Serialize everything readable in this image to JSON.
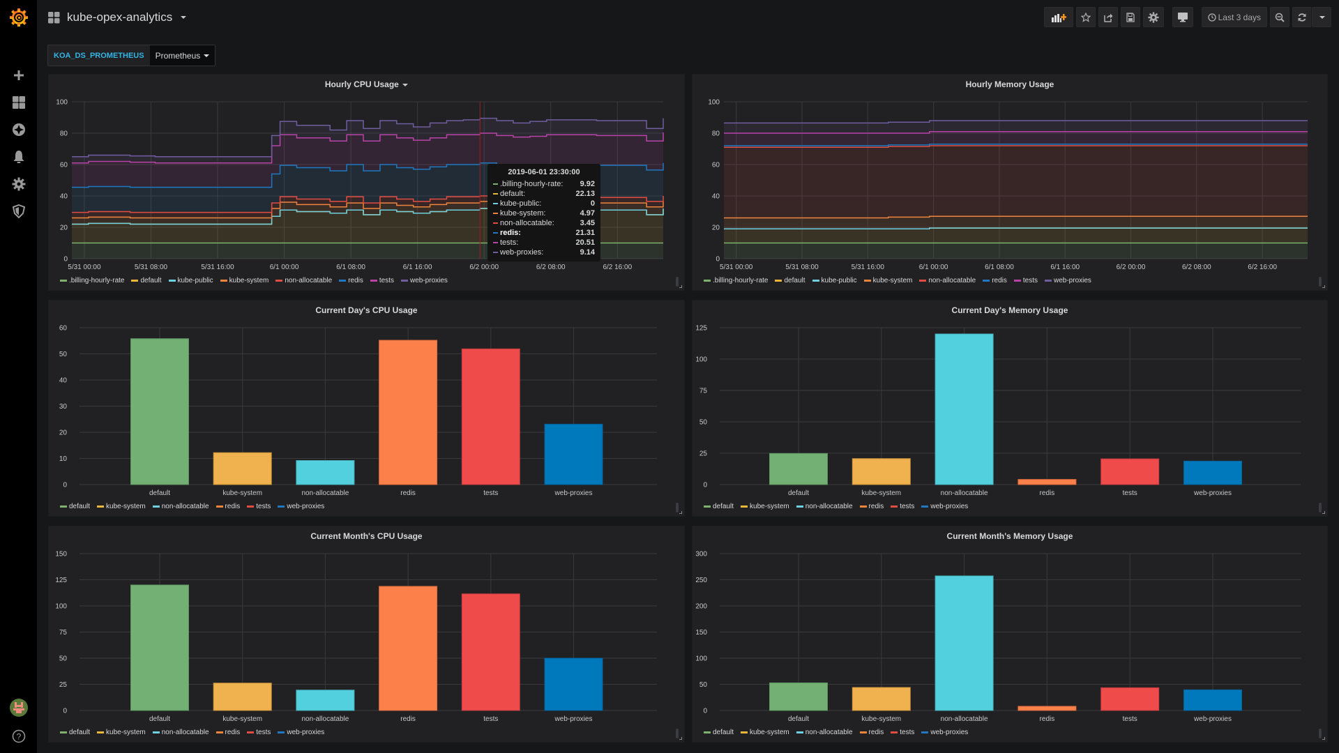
{
  "app": {
    "dashboard_title": "kube-opex-analytics",
    "sidemenu": [
      {
        "icon": "plus-icon",
        "label": "Create"
      },
      {
        "icon": "dashboards-icon",
        "label": "Dashboards"
      },
      {
        "icon": "explore-compass-icon",
        "label": "Explore"
      },
      {
        "icon": "alerting-bell-icon",
        "label": "Alerting"
      },
      {
        "icon": "configuration-gear-icon",
        "label": "Configuration"
      },
      {
        "icon": "server-admin-shield-icon",
        "label": "Server Admin"
      }
    ],
    "help_icon": "help-icon"
  },
  "toolbar": {
    "add_panel": "add-panel-icon",
    "star": "star-icon",
    "share": "share-icon",
    "save": "save-icon",
    "settings": "settings-icon",
    "tv_mode": "tv-mode-icon",
    "time_range_label": "Last 3 days",
    "zoom_out": "zoom-out-icon",
    "refresh": "refresh-icon"
  },
  "variables": {
    "label": "KOA_DS_PROMETHEUS",
    "value": "Prometheus"
  },
  "colors": {
    "billing": "#7eb26d",
    "default": "#eab839",
    "kube-public": "#6ed0e0",
    "kube-system": "#ef843c",
    "non-allocatable": "#e24d42",
    "redis": "#1f78c1",
    "tests": "#ba43a9",
    "web-proxies": "#705da0",
    "bar-default": "#73b074",
    "bar-kube-system": "#f0b24f",
    "bar-non-allocatable": "#53d0de",
    "bar-redis": "#fb804a",
    "bar-tests": "#ef4b4b",
    "bar-web-proxies": "#0079bc"
  },
  "tooltip": {
    "title": "2019-06-01 23:30:00",
    "rows": [
      {
        "name": ".billing-hourly-rate:",
        "value": "9.92",
        "color": "#7eb26d"
      },
      {
        "name": "default:",
        "value": "22.13",
        "color": "#eab839"
      },
      {
        "name": "kube-public:",
        "value": "0",
        "color": "#6ed0e0"
      },
      {
        "name": "kube-system:",
        "value": "4.97",
        "color": "#ef843c"
      },
      {
        "name": "non-allocatable:",
        "value": "3.45",
        "color": "#e24d42"
      },
      {
        "name": "redis:",
        "value": "21.31",
        "color": "#1f78c1"
      },
      {
        "name": "tests:",
        "value": "20.51",
        "color": "#ba43a9"
      },
      {
        "name": "web-proxies:",
        "value": "9.14",
        "color": "#705da0"
      }
    ]
  },
  "chart_data": [
    {
      "id": "hourly-cpu",
      "type": "area",
      "stacked": true,
      "title": "Hourly CPU Usage",
      "ylim": [
        0,
        100
      ],
      "yticks": [
        0,
        20,
        40,
        60,
        80,
        100
      ],
      "xticks": [
        "5/31 00:00",
        "5/31 08:00",
        "5/31 16:00",
        "6/1 00:00",
        "6/1 08:00",
        "6/1 16:00",
        "6/2 00:00",
        "6/2 08:00",
        "6/2 16:00"
      ],
      "x_range_hours": [
        -1.5,
        69.5
      ],
      "grid": true,
      "legend": "bottom",
      "hover_hour": 47.5,
      "series_names": [
        ".billing-hourly-rate",
        "default",
        "kube-public",
        "kube-system",
        "non-allocatable",
        "redis",
        "tests",
        "web-proxies"
      ],
      "stack_tops": {
        "hours": [
          -1.5,
          0.5,
          2.5,
          5.5,
          8.5,
          12.5,
          16.5,
          19.5,
          22.5,
          23.5,
          25.5,
          27.5,
          29.5,
          31.5,
          33.5,
          35.5,
          37.5,
          39.5,
          41.5,
          43.5,
          45.5,
          47.5,
          49.5,
          51.5,
          53.5,
          55.5,
          57.5,
          59.5,
          61.5,
          63.5,
          65.5,
          67.5,
          69.5
        ],
        ".billing-hourly-rate": [
          10,
          10,
          10,
          10,
          10,
          10,
          10,
          10,
          10,
          10,
          10,
          10,
          10,
          10,
          10,
          10,
          10,
          10,
          10,
          10,
          10,
          10,
          10,
          10,
          10,
          10,
          10,
          10,
          10,
          10,
          10,
          10,
          10
        ],
        "default": [
          22,
          22.5,
          22.5,
          22,
          22,
          22,
          22,
          22,
          27,
          31,
          30,
          30,
          29,
          31,
          28,
          31,
          30,
          29,
          30,
          31,
          31,
          32,
          31,
          30,
          31,
          31,
          31,
          31,
          31,
          31,
          31,
          28,
          32
        ],
        "kube-public": [
          22,
          22.5,
          22.5,
          22,
          22,
          22,
          22,
          22,
          27,
          31,
          30,
          30,
          29,
          31,
          28,
          31,
          30,
          29,
          30,
          31,
          31,
          32,
          31,
          30,
          31,
          31,
          31,
          31,
          31,
          31,
          31,
          28,
          32
        ],
        "kube-system": [
          26,
          26.5,
          26.5,
          26,
          26,
          26,
          26,
          26,
          32,
          36,
          34.5,
          34.5,
          33,
          35.5,
          32,
          35.5,
          34,
          33,
          34.5,
          35.5,
          35.5,
          36.5,
          35.5,
          35,
          35.5,
          35.5,
          35.5,
          35.5,
          35.5,
          35.5,
          35.5,
          33,
          36.5
        ],
        "non-allocatable": [
          29.5,
          30,
          30,
          29.5,
          29.5,
          29.5,
          29.5,
          29.5,
          35.5,
          39.5,
          38,
          38,
          36.5,
          39.5,
          35.5,
          39.5,
          38,
          36.5,
          38,
          39.5,
          39.5,
          40,
          39,
          38.5,
          39,
          39,
          39,
          39,
          39,
          39,
          39,
          36.5,
          40
        ],
        "redis": [
          45.5,
          46,
          46,
          45.5,
          45.5,
          45.5,
          45.5,
          45.5,
          54,
          59.5,
          58,
          58,
          56,
          60,
          56,
          60,
          58,
          57,
          58.5,
          60,
          60,
          61,
          59.5,
          59,
          59.5,
          60,
          60,
          60,
          59.5,
          59.5,
          59.5,
          56.5,
          61
        ],
        "tests": [
          61,
          62,
          62,
          61.5,
          61,
          61,
          61,
          61,
          72,
          79,
          77,
          77,
          75,
          79,
          75,
          79,
          77,
          75.5,
          77,
          79,
          79,
          80,
          78.5,
          77.5,
          78,
          79,
          79,
          79,
          78.5,
          78.5,
          78.5,
          75,
          80.5
        ],
        "web-proxies": [
          65,
          66,
          66,
          65.5,
          65,
          65,
          65,
          65,
          78.5,
          87.5,
          85,
          85,
          82,
          88,
          83,
          88,
          86,
          84,
          86.5,
          88,
          88.5,
          89.5,
          88,
          86.5,
          87.5,
          88.5,
          88.5,
          88.5,
          88,
          88,
          88,
          83,
          89.5
        ]
      }
    },
    {
      "id": "hourly-memory",
      "type": "area",
      "stacked": true,
      "title": "Hourly Memory Usage",
      "ylim": [
        0,
        100
      ],
      "yticks": [
        0,
        20,
        40,
        60,
        80,
        100
      ],
      "xticks": [
        "5/31 00:00",
        "5/31 08:00",
        "5/31 16:00",
        "6/1 00:00",
        "6/1 08:00",
        "6/1 16:00",
        "6/2 00:00",
        "6/2 08:00",
        "6/2 16:00"
      ],
      "x_range_hours": [
        -1.5,
        69.5
      ],
      "grid": true,
      "legend": "bottom",
      "series_names": [
        ".billing-hourly-rate",
        "default",
        "kube-public",
        "kube-system",
        "non-allocatable",
        "redis",
        "tests",
        "web-proxies"
      ],
      "stack_tops": {
        "hours": [
          -1.5,
          8.5,
          18.5,
          23.5,
          33.5,
          43.5,
          53.5,
          63.5,
          69.5
        ],
        ".billing-hourly-rate": [
          10,
          10,
          10,
          10,
          10,
          10,
          10,
          10,
          10
        ],
        "default": [
          19,
          19,
          19,
          19.5,
          19.5,
          19.5,
          19.5,
          19.5,
          19.5
        ],
        "kube-public": [
          19,
          19,
          19,
          19.5,
          19.5,
          19.5,
          19.5,
          19.5,
          19.5
        ],
        "kube-system": [
          26,
          26,
          26.5,
          27,
          27,
          27,
          27,
          27,
          27
        ],
        "non-allocatable": [
          71,
          71,
          71.5,
          72,
          72,
          72,
          72,
          72,
          72
        ],
        "redis": [
          72,
          72,
          72.5,
          73,
          73,
          73,
          73,
          73,
          73
        ],
        "tests": [
          80,
          80,
          80,
          81,
          81,
          81,
          81,
          81,
          81
        ],
        "web-proxies": [
          86.5,
          86.5,
          87,
          88,
          88,
          88,
          88,
          88,
          88
        ]
      }
    },
    {
      "id": "day-cpu",
      "type": "bar",
      "title": "Current Day's CPU Usage",
      "categories": [
        "default",
        "kube-system",
        "non-allocatable",
        "redis",
        "tests",
        "web-proxies"
      ],
      "values": [
        55.8,
        12.2,
        9.2,
        55.2,
        51.9,
        23.1
      ],
      "ylim": [
        0,
        60
      ],
      "yticks": [
        0,
        10,
        20,
        30,
        40,
        50,
        60
      ],
      "grid": true,
      "legend": "bottom"
    },
    {
      "id": "day-memory",
      "type": "bar",
      "title": "Current Day's Memory Usage",
      "categories": [
        "default",
        "kube-system",
        "non-allocatable",
        "redis",
        "tests",
        "web-proxies"
      ],
      "values": [
        24.8,
        20.7,
        120,
        4.1,
        20.5,
        18.7
      ],
      "ylim": [
        0,
        125
      ],
      "yticks": [
        0,
        25,
        50,
        75,
        100,
        125
      ],
      "grid": true,
      "legend": "bottom"
    },
    {
      "id": "month-cpu",
      "type": "bar",
      "title": "Current Month's CPU Usage",
      "categories": [
        "default",
        "kube-system",
        "non-allocatable",
        "redis",
        "tests",
        "web-proxies"
      ],
      "values": [
        120,
        26.2,
        19.5,
        118.7,
        111.5,
        50
      ],
      "ylim": [
        0,
        150
      ],
      "yticks": [
        0,
        25,
        50,
        75,
        100,
        125,
        150
      ],
      "grid": true,
      "legend": "bottom"
    },
    {
      "id": "month-memory",
      "type": "bar",
      "title": "Current Month's Memory Usage",
      "categories": [
        "default",
        "kube-system",
        "non-allocatable",
        "redis",
        "tests",
        "web-proxies"
      ],
      "values": [
        52.8,
        44,
        257.3,
        8,
        43.5,
        39.5
      ],
      "ylim": [
        0,
        300
      ],
      "yticks": [
        0,
        50,
        100,
        150,
        200,
        250,
        300
      ],
      "grid": true,
      "legend": "bottom"
    }
  ],
  "legends": {
    "timeseries": [
      {
        "label": ".billing-hourly-rate",
        "color": "#7eb26d"
      },
      {
        "label": "default",
        "color": "#eab839"
      },
      {
        "label": "kube-public",
        "color": "#6ed0e0"
      },
      {
        "label": "kube-system",
        "color": "#ef843c"
      },
      {
        "label": "non-allocatable",
        "color": "#e24d42"
      },
      {
        "label": "redis",
        "color": "#1f78c1"
      },
      {
        "label": "tests",
        "color": "#ba43a9"
      },
      {
        "label": "web-proxies",
        "color": "#705da0"
      }
    ],
    "bars": [
      {
        "label": "default",
        "color": "#7eb26d"
      },
      {
        "label": "kube-system",
        "color": "#eab839"
      },
      {
        "label": "non-allocatable",
        "color": "#6ed0e0"
      },
      {
        "label": "redis",
        "color": "#ef843c"
      },
      {
        "label": "tests",
        "color": "#e24d42"
      },
      {
        "label": "web-proxies",
        "color": "#1f78c1"
      }
    ]
  }
}
